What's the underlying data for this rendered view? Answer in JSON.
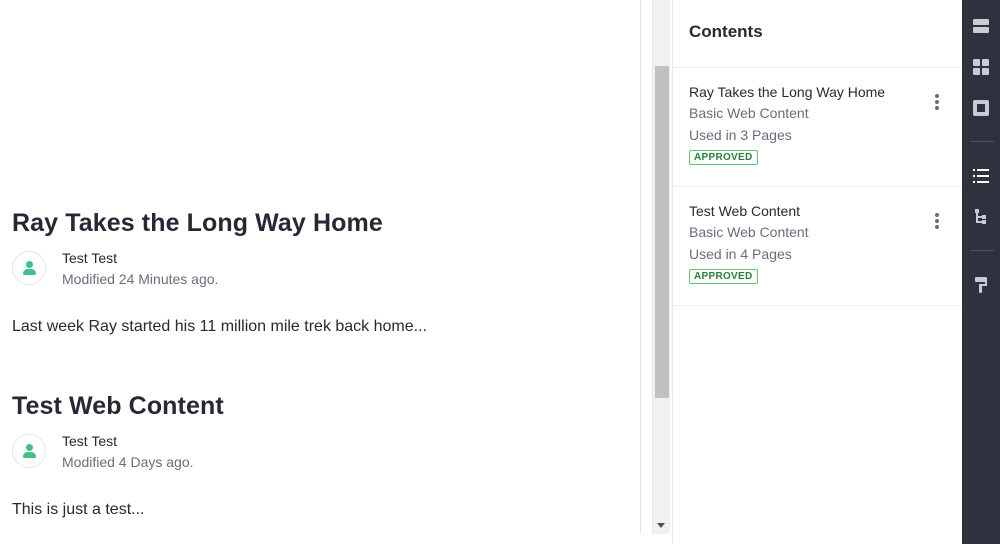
{
  "articles": [
    {
      "title": "Ray Takes the Long Way Home",
      "author": "Test Test",
      "modified": "Modified 24 Minutes ago.",
      "excerpt": "Last week Ray started his 11 million mile trek back home..."
    },
    {
      "title": "Test Web Content",
      "author": "Test Test",
      "modified": "Modified 4 Days ago.",
      "excerpt": "This is just a test..."
    }
  ],
  "panel": {
    "title": "Contents",
    "items": [
      {
        "title": "Ray Takes the Long Way Home",
        "type": "Basic Web Content",
        "usage": "Used in 3 Pages",
        "status": "APPROVED"
      },
      {
        "title": "Test Web Content",
        "type": "Basic Web Content",
        "usage": "Used in 4 Pages",
        "status": "APPROVED"
      }
    ]
  },
  "rail": {
    "icons": [
      "fragments-icon",
      "widgets-icon",
      "page-structure-icon",
      "contents-list-icon",
      "tree-icon",
      "paint-roller-icon"
    ],
    "active": "contents-list-icon"
  },
  "colors": {
    "rail_bg": "#30313f",
    "avatar_green": "#3ec28a",
    "approved_green": "#287d3c"
  }
}
